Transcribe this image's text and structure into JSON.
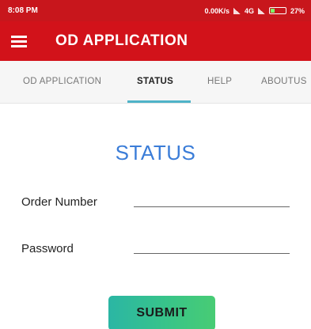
{
  "status_bar": {
    "time": "8:08 PM",
    "network": "0.00K/s",
    "network_type": "4G",
    "battery": "27%",
    "battery_level": 0.27
  },
  "app_bar": {
    "menu_icon": "hamburger-menu-icon",
    "title": "OD APPLICATION"
  },
  "tabs": [
    {
      "label": "OD APPLICATION",
      "active": false
    },
    {
      "label": "STATUS",
      "active": true
    },
    {
      "label": "HELP",
      "active": false
    },
    {
      "label": "ABOUTUS",
      "active": false
    }
  ],
  "main": {
    "heading": "STATUS",
    "order_number": {
      "label": "Order Number",
      "value": ""
    },
    "password": {
      "label": "Password",
      "value": ""
    },
    "submit_label": "SUBMIT"
  },
  "colors": {
    "app_bar": "#d2121a",
    "tab_indicator": "#4fb3c8",
    "heading": "#3b7dd8",
    "submit_gradient_start": "#2bb6a4",
    "submit_gradient_end": "#48cc74"
  }
}
